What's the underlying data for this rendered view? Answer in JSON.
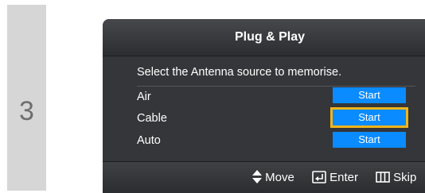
{
  "step": {
    "number": "3"
  },
  "dialog": {
    "title": "Plug & Play",
    "instruction": "Select the Antenna source to memorise.",
    "sources": [
      {
        "label": "Air",
        "button_label": "Start"
      },
      {
        "label": "Cable",
        "button_label": "Start",
        "focused": true
      },
      {
        "label": "Auto",
        "button_label": "Start"
      }
    ]
  },
  "footer": {
    "hints": [
      {
        "icon": "up-down-arrow-icon",
        "label": "Move"
      },
      {
        "icon": "enter-icon",
        "label": "Enter"
      },
      {
        "icon": "skip-icon",
        "label": "Skip"
      }
    ]
  },
  "colors": {
    "button": "#0a8bff",
    "focus_ring": "#f0b51a",
    "dialog_bg": "#343639",
    "step_strip": "#d6d6d6"
  }
}
